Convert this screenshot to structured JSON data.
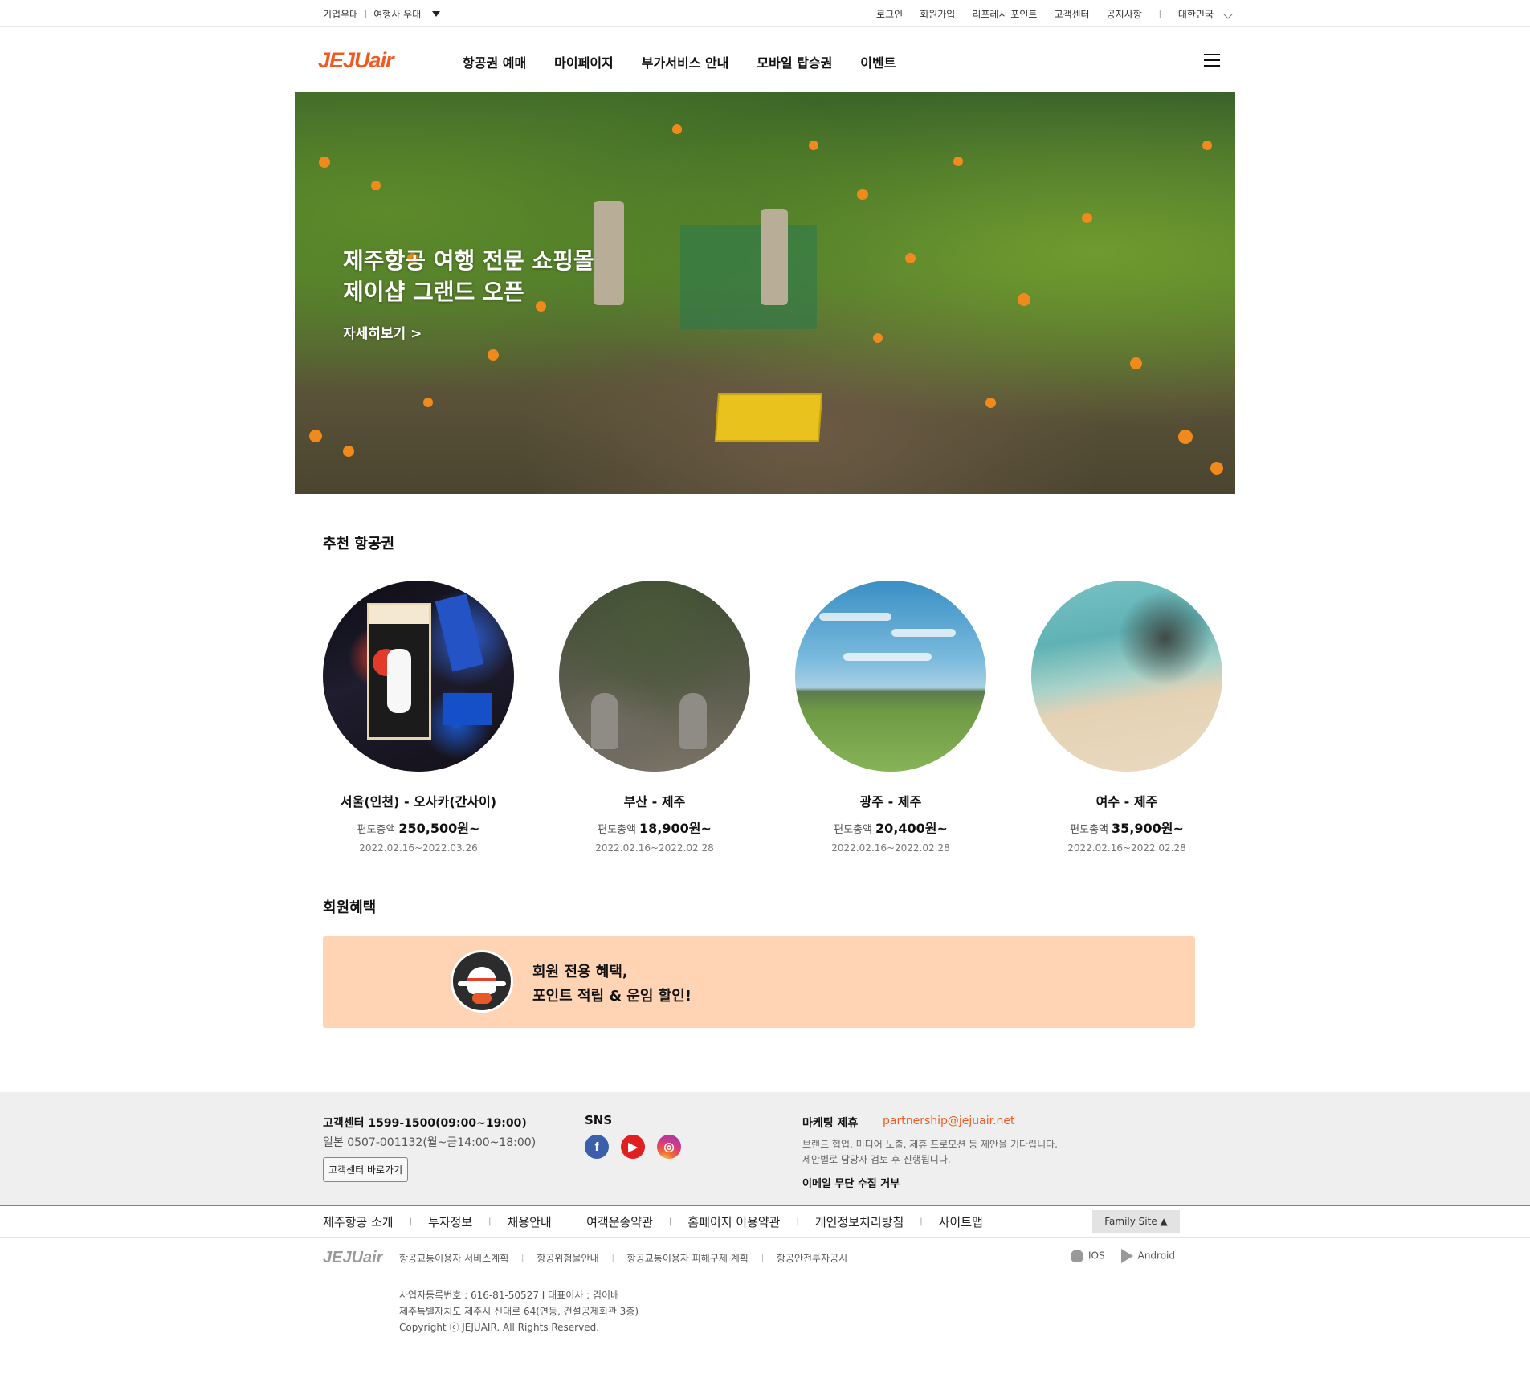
{
  "util_bar": {
    "left_items": [
      "기업우대",
      "여행사 우대"
    ],
    "right_items": [
      "로그인",
      "회원가입",
      "리프레시 포인트",
      "고객센터",
      "공지사항"
    ],
    "country": "대한민국"
  },
  "header": {
    "logo_prefix": "JEJU",
    "logo_suffix": "air",
    "nav": [
      "항공권 예매",
      "마이페이지",
      "부가서비스 안내",
      "모바일 탑승권",
      "이벤트"
    ]
  },
  "hero": {
    "title_line1": "제주항공 여행 전문 쇼핑몰",
    "title_line2": "제이샵 그랜드 오픈",
    "link": "자세히보기 >"
  },
  "recommend": {
    "title": "추천 항공권",
    "price_label": "편도총액",
    "cards": [
      {
        "route": "서울(인천) - 오사카(간사이)",
        "price": "250,500원~",
        "dates": "2022.02.16~2022.03.26"
      },
      {
        "route": "부산 - 제주",
        "price": "18,900원~",
        "dates": "2022.02.16~2022.02.28"
      },
      {
        "route": "광주 - 제주",
        "price": "20,400원~",
        "dates": "2022.02.16~2022.02.28"
      },
      {
        "route": "여수 - 제주",
        "price": "35,900원~",
        "dates": "2022.02.16~2022.02.28"
      }
    ]
  },
  "membership": {
    "title": "회원혜택",
    "line1": "회원 전용 혜택,",
    "line2": "포인트 적립 & 운임 할인!",
    "badge_icon": "plane-badge-icon"
  },
  "footer": {
    "cs_title": "고객센터 1599-1500(09:00~19:00)",
    "cs_sub": "일본 0507-001132(월~금14:00~18:00)",
    "cs_button": "고객센터 바로가기",
    "sns_title": "SNS",
    "sns_icons": [
      "facebook-icon",
      "youtube-icon",
      "instagram-icon"
    ],
    "marketing_title": "마케팅 제휴",
    "marketing_email": "partnership@jejuair.net",
    "marketing_desc1": "브랜드 협업, 미디어 노출, 제휴 프로모션 등 제안을 기다립니다.",
    "marketing_desc2": "제안별로 담당자 검토 후 진행됩니다.",
    "email_refuse": "이메일 무단 수집 거부",
    "nav": [
      "제주항공 소개",
      "투자정보",
      "채용안내",
      "여객운송약관",
      "홈페이지 이용약관",
      "개인정보처리방침",
      "사이트맵"
    ],
    "family_site": "Family Site ▲",
    "bottom_links": [
      "항공교통이용자 서비스계획",
      "항공위험물안내",
      "항공교통이용자 피해구제 계획",
      "항공안전투자공시"
    ],
    "apps": [
      "IOS",
      "Android"
    ],
    "corp_line1": "사업자등록번호 : 616-81-50527  I  대표이사 : 김이배",
    "corp_line2": "제주특별자치도 제주시 신대로 64(연동, 건설공제회관 3층)",
    "copyright": "Copyright ⓒ JEJUAIR. All Rights Reserved."
  },
  "colors": {
    "brand": "#f15a22",
    "banner_bg": "#ffd4b4",
    "footer_bg": "#efefef"
  }
}
